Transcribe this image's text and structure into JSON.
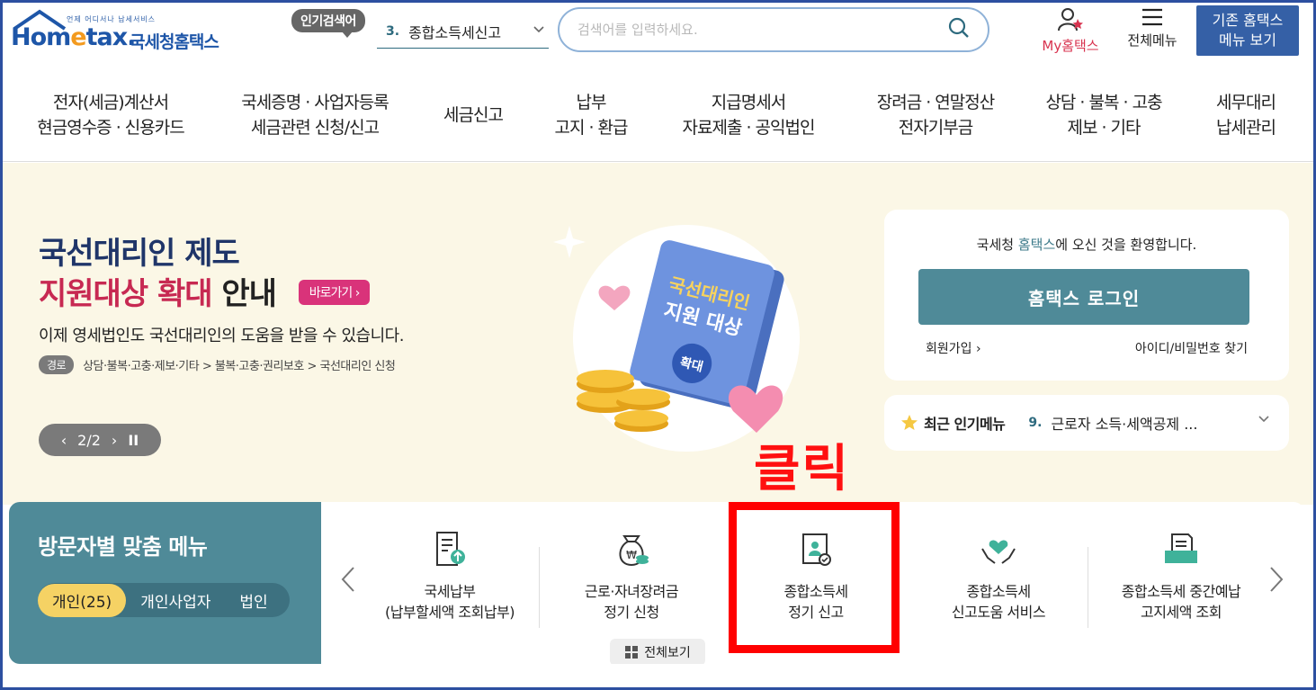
{
  "header": {
    "logo_tag": "언제 어디서나 납세서비스",
    "logo_home": "Hom",
    "logo_e": "e",
    "logo_tax": "tax.",
    "logo_ko": "국세청홈택스",
    "popular_badge": "인기검색어",
    "popular_num": "3.",
    "popular_keyword": "종합소득세신고",
    "search_placeholder": "검색어를 입력하세요.",
    "my_hometax": "My홈택스",
    "all_menu": "전체메뉴",
    "old_menu_line1": "기존 홈택스",
    "old_menu_line2": "메뉴 보기"
  },
  "nav": [
    {
      "l1": "전자(세금)계산서",
      "l2": "현금영수증 · 신용카드"
    },
    {
      "l1": "국세증명 · 사업자등록",
      "l2": "세금관련 신청/신고"
    },
    {
      "l1": "세금신고",
      "l2": ""
    },
    {
      "l1": "납부",
      "l2": "고지 · 환급"
    },
    {
      "l1": "지급명세서",
      "l2": "자료제출 · 공익법인"
    },
    {
      "l1": "장려금 · 연말정산",
      "l2": "전자기부금"
    },
    {
      "l1": "상담 · 불복 · 고충",
      "l2": "제보 · 기타"
    },
    {
      "l1": "세무대리",
      "l2": "납세관리"
    }
  ],
  "banner": {
    "title1": "국선대리인 제도",
    "title2_hl": "지원대상 확대",
    "title2_rest": " 안내",
    "go_button": "바로가기 ›",
    "desc": "이제 영세법인도 국선대리인의 도움을 받을 수 있습니다.",
    "path_tag": "경로",
    "path": "상담·불복·고충·제보·기타 > 불복·고충·권리보호 > 국선대리인 신청",
    "pager": "2/2",
    "book_line1": "국선대리인",
    "book_line2": "지원 대상",
    "book_badge": "확대"
  },
  "login": {
    "welcome_pre": "국세청 ",
    "welcome_hl": "홈택스",
    "welcome_post": "에 오신 것을 환영합니다.",
    "button": "홈택스 로그인",
    "signup": "회원가입 ›",
    "find": "아이디/비밀번호 찾기"
  },
  "recent": {
    "title": "최근 인기메뉴",
    "num": "9.",
    "item": "근로자 소득·세액공제 ..."
  },
  "annotation": {
    "click_label": "클릭",
    "highlight_color": "#ff0000"
  },
  "visitor": {
    "title": "방문자별 맞춤 메뉴",
    "tabs": [
      "개인(25)",
      "개인사업자",
      "법인"
    ],
    "items": [
      {
        "l1": "국세납부",
        "l2": "(납부할세액 조회납부)",
        "icon": "document-upload-icon"
      },
      {
        "l1": "근로·자녀장려금",
        "l2": "정기 신청",
        "icon": "money-bag-icon"
      },
      {
        "l1": "종합소득세",
        "l2": "정기 신고",
        "icon": "tax-report-icon"
      },
      {
        "l1": "종합소득세",
        "l2": "신고도움 서비스",
        "icon": "hands-heart-icon"
      },
      {
        "l1": "종합소득세 중간예납",
        "l2": "고지세액 조회",
        "icon": "folder-document-icon"
      }
    ],
    "view_all": "전체보기"
  },
  "colors": {
    "brand_blue": "#1e56a8",
    "teal": "#4f8a98",
    "accent_pink": "#d9337a",
    "tab_yellow": "#f5d264"
  }
}
